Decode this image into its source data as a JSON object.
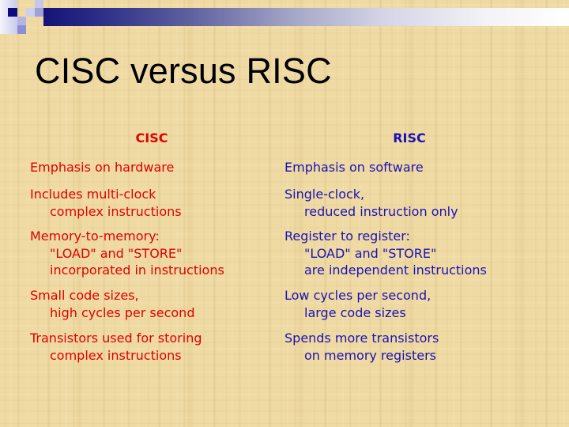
{
  "slide": {
    "title": "CISC versus RISC"
  },
  "colors": {
    "cisc_text": "#e00000",
    "risc_text": "#1a12b4",
    "title_text": "#000000",
    "header_bar_start": "#141478",
    "header_bar_end": "#ffffff",
    "background": "#efdaa4"
  },
  "comparison": {
    "cisc": {
      "header": "CISC",
      "items": [
        {
          "lines": [
            "Emphasis on hardware"
          ]
        },
        {
          "lines": [
            "Includes multi-clock",
            "complex instructions"
          ]
        },
        {
          "lines": [
            "Memory-to-memory:",
            "\"LOAD\" and \"STORE\"",
            "incorporated in instructions"
          ]
        },
        {
          "lines": [
            "Small code sizes,",
            "high cycles per second"
          ]
        },
        {
          "lines": [
            "Transistors used for storing",
            "complex instructions"
          ]
        }
      ]
    },
    "risc": {
      "header": "RISC",
      "items": [
        {
          "lines": [
            "Emphasis on software"
          ]
        },
        {
          "lines": [
            "Single-clock,",
            "reduced instruction only"
          ]
        },
        {
          "lines": [
            "Register to register:",
            "\"LOAD\" and \"STORE\"",
            "are independent instructions"
          ]
        },
        {
          "lines": [
            "Low cycles per second,",
            "large code sizes"
          ]
        },
        {
          "lines": [
            "Spends more transistors",
            "on memory registers"
          ]
        }
      ]
    }
  }
}
